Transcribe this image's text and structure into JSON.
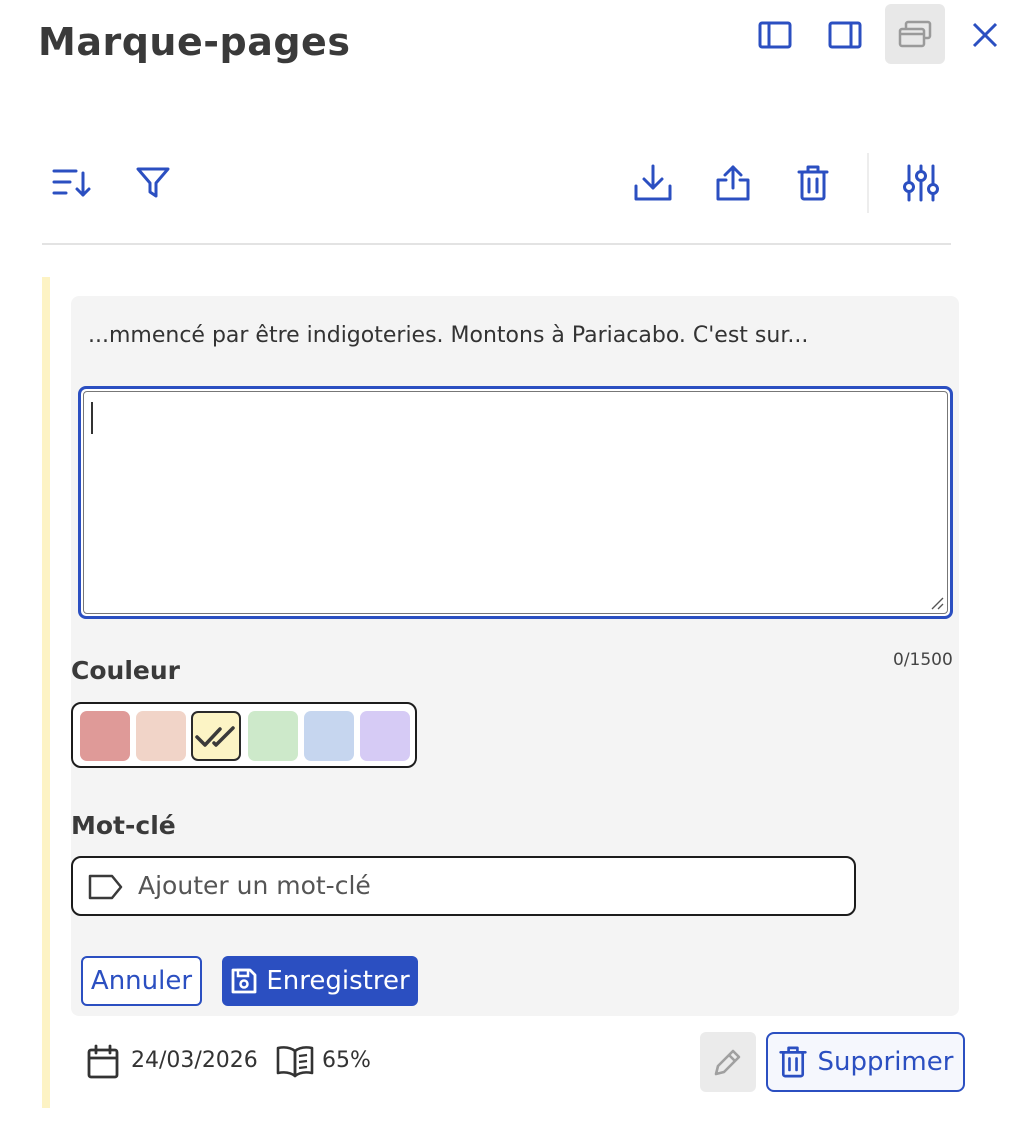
{
  "header": {
    "title": "Marque-pages",
    "window_icons": [
      "dock-left-icon",
      "dock-right-icon",
      "popout-window-icon",
      "close-icon"
    ]
  },
  "toolbar": {
    "left_icons": [
      "sort-icon",
      "filter-icon"
    ],
    "right_icons": [
      "download-icon",
      "share-icon",
      "trash-icon",
      "settings-sliders-icon"
    ]
  },
  "bookmark": {
    "highlight_color": "#fdf3c4",
    "excerpt": "...mmencé par être indigoteries. Montons à Pariacabo. C'est sur...",
    "note": {
      "value": "",
      "counter": "0/1500"
    },
    "color_label": "Couleur",
    "colors": [
      {
        "hex": "#df9a98",
        "selected": false
      },
      {
        "hex": "#f1d4c8",
        "selected": false
      },
      {
        "hex": "#fcf4c5",
        "selected": true
      },
      {
        "hex": "#cde9ca",
        "selected": false
      },
      {
        "hex": "#c6d6ef",
        "selected": false
      },
      {
        "hex": "#d6cbf5",
        "selected": false
      }
    ],
    "keyword_label": "Mot-clé",
    "keyword_placeholder": "Ajouter un mot-clé",
    "cancel_label": "Annuler",
    "save_label": "Enregistrer",
    "date": "24/03/2026",
    "progress": "65%",
    "delete_label": "Supprimer"
  },
  "colors": {
    "accent": "#2b4fc1",
    "card_bg": "#f4f4f4"
  }
}
